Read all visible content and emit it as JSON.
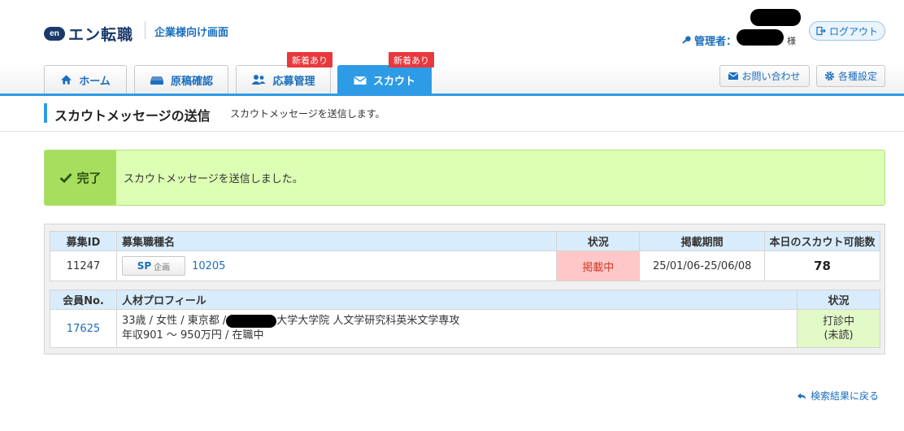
{
  "header": {
    "logo_mark": "en",
    "logo_text": "エン転職",
    "corp_link": "企業様向け画面",
    "admin_label": "管理者：",
    "admin_suffix": "様",
    "logout": "ログアウト"
  },
  "tabs": [
    {
      "label": "ホーム",
      "icon": "home-icon",
      "active": false
    },
    {
      "label": "原稿確認",
      "icon": "document-icon",
      "active": false
    },
    {
      "label": "応募管理",
      "icon": "users-icon",
      "active": false,
      "badge": "新着あり"
    },
    {
      "label": "スカウト",
      "icon": "mail-icon",
      "active": true,
      "badge": "新着あり"
    }
  ],
  "utility": {
    "contact": "お問い合わせ",
    "settings": "各種設定"
  },
  "page": {
    "title": "スカウトメッセージの送信",
    "subtitle": "スカウトメッセージを送信します。"
  },
  "success": {
    "label": "完了",
    "message": "スカウトメッセージを送信しました。"
  },
  "job_table": {
    "headers": [
      "募集ID",
      "募集職種名",
      "状況",
      "掲載期間",
      "本日のスカウト可能数"
    ],
    "row": {
      "id": "11247",
      "sp_label": "SP",
      "sp_suffix": "企画",
      "job_name": "10205",
      "status": "掲載中",
      "period": "25/01/06-25/06/08",
      "scout_count": "78"
    }
  },
  "member_table": {
    "headers": [
      "会員No.",
      "人材プロフィール",
      "状況"
    ],
    "row": {
      "member_no": "17625",
      "profile_line1_a": "33歳 / 女性 / 東京都 /",
      "profile_line1_b": "大学大学院 人文学研究科英米文学専攻",
      "profile_line2": "年収901 ～ 950万円 / 在職中",
      "status_line1": "打診中",
      "status_line2": "(未読)"
    }
  },
  "back_link": "検索結果に戻る",
  "colors": {
    "accent": "#2e9be6",
    "link": "#1a6fbf",
    "badge": "#e8383d",
    "success_bg": "#dcffb4",
    "success_label_bg": "#a6df5e"
  }
}
